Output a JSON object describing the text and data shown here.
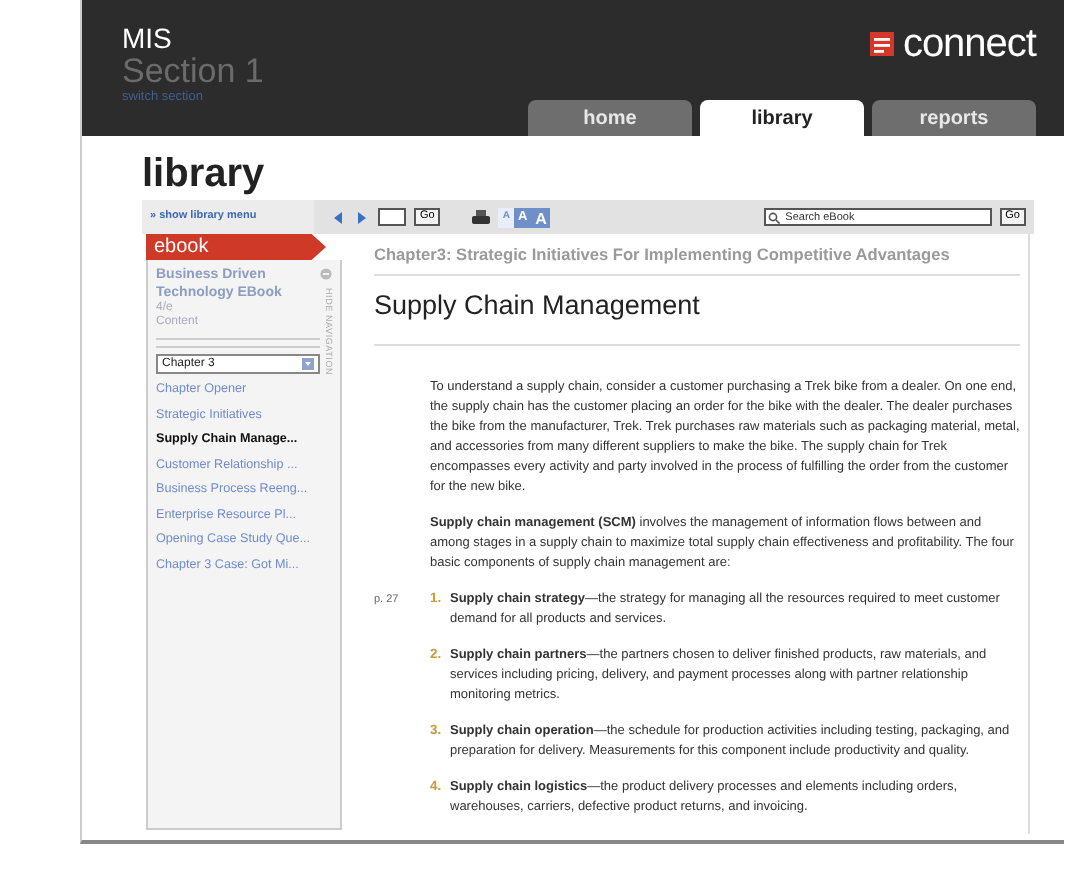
{
  "header": {
    "course": "MIS",
    "section": "Section 1",
    "switch_link": "switch section",
    "logo": "connect"
  },
  "tabs": [
    {
      "label": "home",
      "selected": false
    },
    {
      "label": "library",
      "selected": true
    },
    {
      "label": "reports",
      "selected": false
    }
  ],
  "page_title": "library",
  "toolbar": {
    "show_menu": "» show library menu",
    "page_go": "Go",
    "font_sizes": [
      {
        "label": "A",
        "selected": true
      },
      {
        "label": "A",
        "selected": false
      },
      {
        "label": "A",
        "selected": false
      }
    ],
    "search_placeholder": "Search eBook",
    "search_go": "Go"
  },
  "sidebar": {
    "tab": "ebook",
    "book_title": "Business Driven Technology EBook",
    "edition": "4/e",
    "section": "Content",
    "hide_navigation": "HIDE NAVIGATION",
    "chapter_select": "Chapter 3",
    "items": [
      {
        "label": "Chapter Opener",
        "selected": false
      },
      {
        "label": "Strategic Initiatives",
        "selected": false
      },
      {
        "label": "Supply Chain Manage...",
        "selected": true
      },
      {
        "label": "Customer Relationship ...",
        "selected": false
      },
      {
        "label": "Business Process Reeng...",
        "selected": false
      },
      {
        "label": "Enterprise Resource Pl...",
        "selected": false
      },
      {
        "label": "Opening Case Study Que...",
        "selected": false
      },
      {
        "label": "Chapter 3 Case: Got Mi...",
        "selected": false
      }
    ]
  },
  "content": {
    "chapter_heading": "Chapter3: Strategic Initiatives For Implementing Competitive Advantages",
    "title": "Supply Chain Management",
    "paragraphs": [
      "To understand a supply chain, consider a customer purchasing a Trek bike from a dealer. On one end, the supply chain has the customer placing an order for the bike with the dealer. The dealer purchases the bike from the manufacturer, Trek. Trek purchases raw materials such as packaging material, metal, and accessories from many different suppliers to make the bike. The supply chain for Trek encompasses every activity and party involved in the process of fulfilling the order from the customer for the new bike.",
      "**Supply chain management (SCM)** involves the management of information flows between and among stages in a supply chain to maximize total supply chain effectiveness and profitability. The four basic components of supply chain management are:"
    ],
    "page_marker": "p. 27",
    "components": [
      {
        "number": "1.",
        "text": "**Supply chain strategy**—the strategy for managing all the resources required to meet customer demand for all products and services."
      },
      {
        "number": "2.",
        "text": "**Supply chain partners**—the partners chosen to deliver finished products, raw materials, and services including pricing, delivery, and payment processes along with partner relationship monitoring metrics."
      },
      {
        "number": "3.",
        "text": "**Supply chain operation**—the schedule for production activities including testing, packaging, and preparation for delivery. Measurements for this component include productivity and quality."
      },
      {
        "number": "4.",
        "text": "**Supply chain logistics**—the product delivery processes and elements including orders, warehouses, carriers, defective product returns, and invoicing."
      }
    ]
  }
}
